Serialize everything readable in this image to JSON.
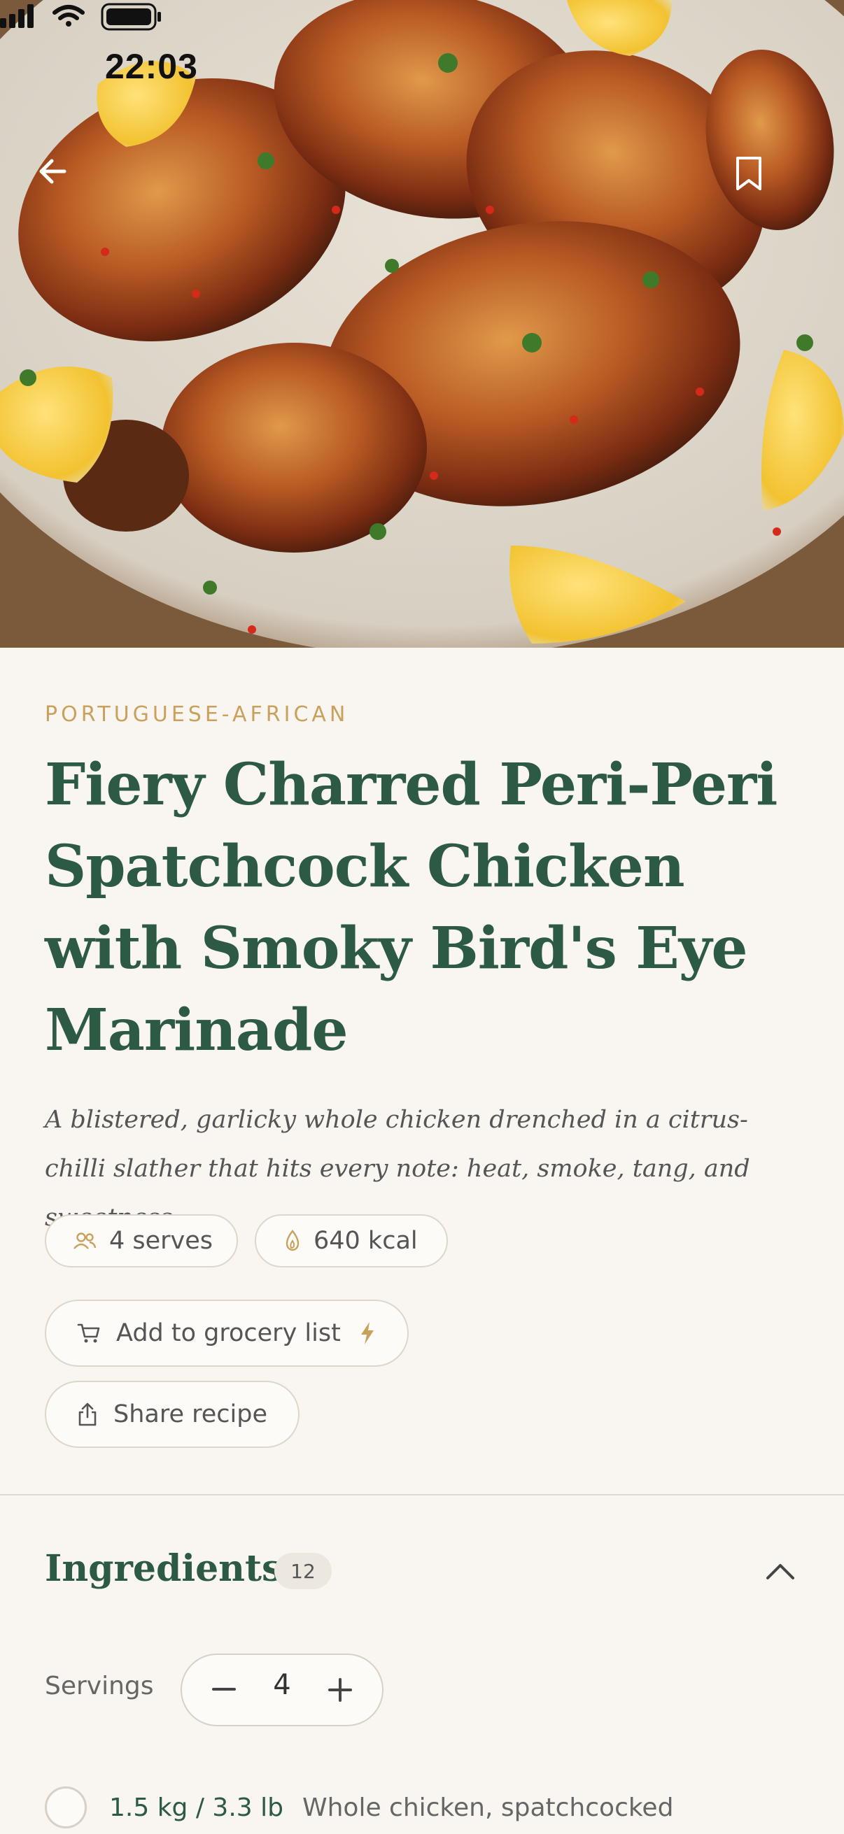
{
  "status_bar": {
    "time": "22:03"
  },
  "hero": {
    "image_alt": "Charred peri-peri chicken pieces with lemon wedges on a plate"
  },
  "recipe": {
    "cuisine": "PORTUGUESE-AFRICAN",
    "title": "Fiery Charred Peri-Peri Spatchcock Chicken with Smoky Bird's Eye Marinade",
    "description": "A blistered, garlicky whole chicken drenched in a citrus-chilli slather that hits every note: heat, smoke, tang, and sweetness.",
    "serves": "4 serves",
    "kcal": "640 kcal"
  },
  "actions": {
    "grocery_label": "Add to grocery list",
    "share_label": "Share recipe"
  },
  "ingredients": {
    "title": "Ingredients",
    "count": "12",
    "servings_label": "Servings",
    "servings_value": "4",
    "items": [
      {
        "qty": "1.5 kg / 3.3 lb",
        "name": "Whole chicken, spatchcocked",
        "checked": false
      }
    ]
  },
  "colors": {
    "accent_green": "#2d5a42",
    "gold": "#c9a15d",
    "background": "#f9f6f1"
  },
  "icons": [
    "back-arrow-icon",
    "bookmark-icon",
    "people-icon",
    "flame-icon",
    "cart-icon",
    "bolt-icon",
    "share-icon",
    "chevron-up-icon",
    "minus-icon",
    "plus-icon"
  ]
}
